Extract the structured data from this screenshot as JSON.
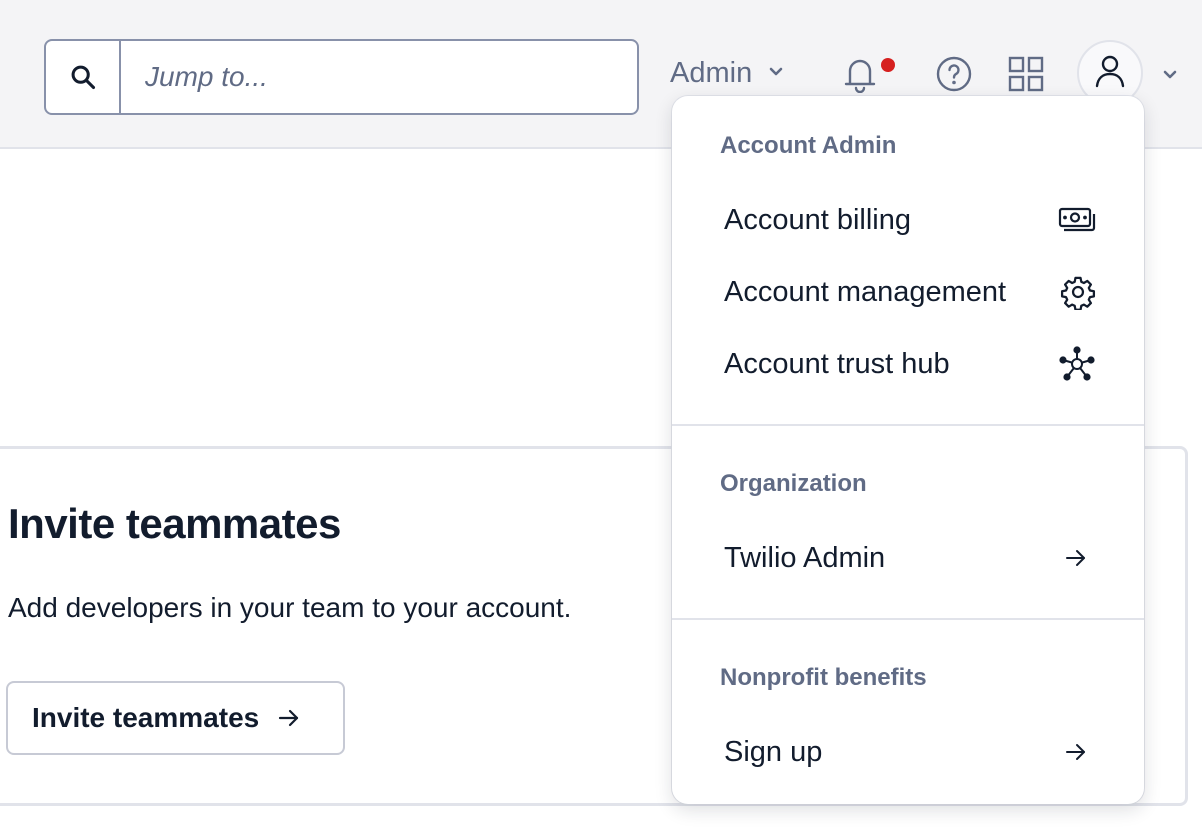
{
  "search": {
    "placeholder": "Jump to..."
  },
  "header": {
    "admin_label": "Admin",
    "icons": [
      "search-icon",
      "bell-icon",
      "help-icon",
      "apps-grid-icon",
      "user-icon",
      "chevron-down-icon"
    ],
    "notification_dot_color": "#d6201f"
  },
  "card": {
    "title": "Invite teammates",
    "description": "Add developers in your team to your account.",
    "button_label": "Invite teammates"
  },
  "dropdown": {
    "sections": [
      {
        "title": "Account Admin",
        "items": [
          {
            "label": "Account billing",
            "icon": "billing-cash-icon"
          },
          {
            "label": "Account management",
            "icon": "gear-icon"
          },
          {
            "label": "Account trust hub",
            "icon": "trust-hub-network-icon"
          }
        ]
      },
      {
        "title": "Organization",
        "items": [
          {
            "label": "Twilio Admin",
            "icon": "arrow-right-icon"
          }
        ]
      },
      {
        "title": "Nonprofit benefits",
        "items": [
          {
            "label": "Sign up",
            "icon": "arrow-right-icon"
          }
        ]
      }
    ]
  }
}
